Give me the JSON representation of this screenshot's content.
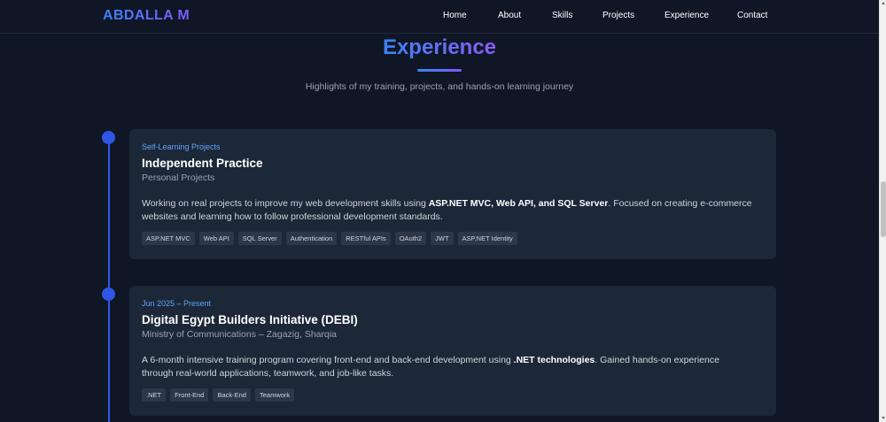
{
  "navbar": {
    "brand": "ABDALLA M",
    "links": [
      "Home",
      "About",
      "Skills",
      "Projects",
      "Experience",
      "Contact"
    ]
  },
  "section": {
    "title": "Experience",
    "subtitle": "Highlights of my training, projects, and hands-on learning journey"
  },
  "experience": [
    {
      "date": "Self-Learning Projects",
      "title": "Independent Practice",
      "org": "Personal Projects",
      "desc_parts": [
        {
          "text": "Working on real projects to improve my web development skills using ",
          "bold": false
        },
        {
          "text": "ASP.NET MVC, Web API, and SQL Server",
          "bold": true
        },
        {
          "text": ". Focused on creating e-commerce websites and learning how to follow professional development standards.",
          "bold": false
        }
      ],
      "tags": [
        "ASP.NET MVC",
        "Web API",
        "SQL Server",
        "Authentication",
        "RESTful APIs",
        "OAuth2",
        "JWT",
        "ASP.NET Identity"
      ]
    },
    {
      "date": "Jun 2025 – Present",
      "title": "Digital Egypt Builders Initiative (DEBI)",
      "org": "Ministry of Communications – Zagazig, Sharqia",
      "desc_parts": [
        {
          "text": "A 6-month intensive training program covering front-end and back-end development using ",
          "bold": false
        },
        {
          "text": ".NET technologies",
          "bold": true
        },
        {
          "text": ". Gained hands-on experience through real-world applications, teamwork, and job-like tasks.",
          "bold": false
        }
      ],
      "tags": [
        ".NET",
        "Front-End",
        "Back-End",
        "Teamwork"
      ]
    }
  ],
  "colors": {
    "background": "#0f1626",
    "card": "#1c2738",
    "accent": "#3b82f6",
    "accent2": "#8b5cf6",
    "date": "#60a5fa",
    "tag_bg": "#2c3748"
  }
}
